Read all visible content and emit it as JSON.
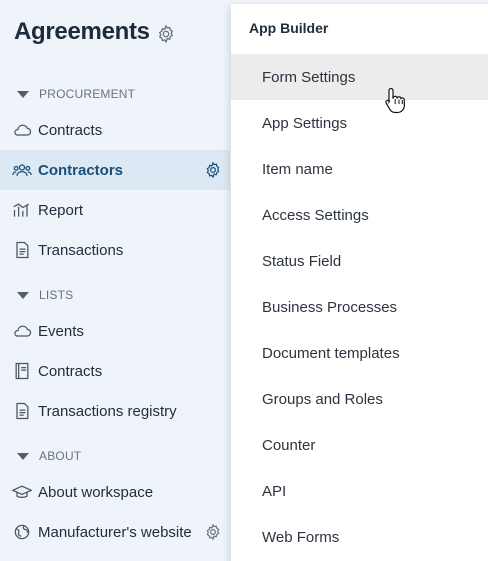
{
  "app": {
    "title": "Agreements",
    "title_icon": "gear-icon"
  },
  "sidebar": {
    "sections": [
      {
        "label": "PROCUREMENT",
        "items": [
          {
            "label": "Contracts",
            "icon": "cloud-icon"
          },
          {
            "label": "Contractors",
            "icon": "users-icon",
            "active": true,
            "trailing_icon": "gear-icon"
          },
          {
            "label": "Report",
            "icon": "bar-chart-icon"
          },
          {
            "label": "Transactions",
            "icon": "document-icon"
          }
        ]
      },
      {
        "label": "LISTS",
        "items": [
          {
            "label": "Events",
            "icon": "cloud-icon"
          },
          {
            "label": "Contracts",
            "icon": "book-icon"
          },
          {
            "label": "Transactions registry",
            "icon": "document-icon"
          }
        ]
      },
      {
        "label": "ABOUT",
        "items": [
          {
            "label": "About workspace",
            "icon": "graduation-cap-icon"
          },
          {
            "label": "Manufacturer's website",
            "icon": "globe-icon",
            "trailing_icon": "gear-icon"
          }
        ]
      }
    ]
  },
  "dropdown": {
    "header": "App Builder",
    "items": [
      {
        "label": "Form Settings",
        "hovered": true
      },
      {
        "label": "App Settings"
      },
      {
        "label": "Item name"
      },
      {
        "label": "Access Settings"
      },
      {
        "label": "Status Field"
      },
      {
        "label": "Business Processes"
      },
      {
        "label": "Document templates"
      },
      {
        "label": "Groups and Roles"
      },
      {
        "label": "Counter"
      },
      {
        "label": "API"
      },
      {
        "label": "Web Forms"
      }
    ]
  },
  "colors": {
    "sidebar_bg": "#eef4fa",
    "active_item_bg": "#dce8f3",
    "active_text": "#1a4f7a",
    "hover_item_bg": "#ececec"
  }
}
